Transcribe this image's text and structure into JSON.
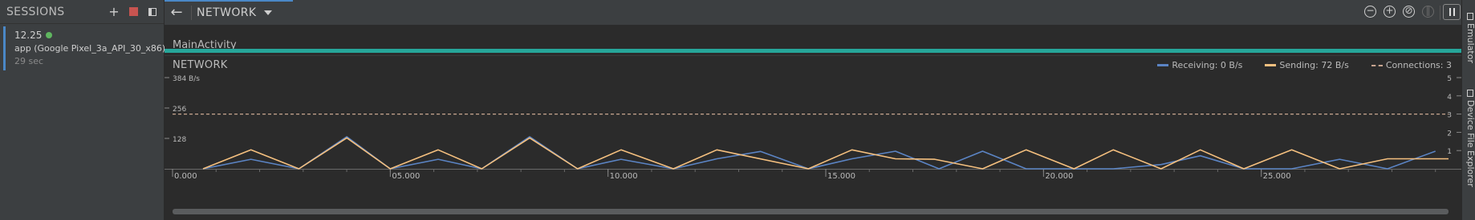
{
  "sessions": {
    "title": "SESSIONS",
    "add_icon": "plus-icon",
    "stop_icon": "stop-icon",
    "panel_icon": "panel-toggle-icon",
    "item": {
      "time": "12.25",
      "app": "app (Google Pixel_3a_API_30_x86)",
      "duration": "29 sec",
      "status_color": "#5fb65f"
    }
  },
  "toolbar": {
    "back_icon": "arrow-left-icon",
    "profiler_label": "NETWORK",
    "zoom_out_icon": "zoom-out-icon",
    "zoom_in_icon": "zoom-in-icon",
    "reset_zoom_icon": "reset-zoom-icon",
    "live_icon": "go-live-icon",
    "pause_icon": "pause-icon"
  },
  "activity": {
    "label": "MainActivity",
    "color": "#26a69a"
  },
  "side_tabs": {
    "emulator": "Emulator",
    "device_file_explorer": "Device File Explorer"
  },
  "chart_data": {
    "type": "line",
    "title": "NETWORK",
    "legend_position": "top-right",
    "legend": [
      {
        "key": "receiving",
        "label": "Receiving: 0 B/s",
        "color": "#5b84c4",
        "style": "solid"
      },
      {
        "key": "sending",
        "label": "Sending: 72 B/s",
        "color": "#f5c07f",
        "style": "solid"
      },
      {
        "key": "connections",
        "label": "Connections:  3",
        "color": "#c8a590",
        "style": "dashed"
      }
    ],
    "x_ticks": [
      "0.000",
      "05.000",
      "10.000",
      "15.000",
      "20.000",
      "25.000"
    ],
    "x_tick_values": [
      0,
      5,
      10,
      15,
      20,
      25
    ],
    "x_range": [
      0,
      29.3
    ],
    "y_left_ticks": [
      "384 B/s",
      "256",
      "128"
    ],
    "y_left_tick_values": [
      384,
      256,
      128
    ],
    "y_left_range": [
      0,
      384
    ],
    "y_right_ticks": [
      "5",
      "4",
      "3",
      "2",
      "1"
    ],
    "y_right_tick_values": [
      5,
      4,
      3,
      2,
      1
    ],
    "y_right_range": [
      0,
      5
    ],
    "grid": false,
    "series": [
      {
        "name": "Receiving",
        "axis": "left",
        "color": "#5b84c4",
        "x": [
          0.7,
          1.8,
          2.9,
          4.0,
          5.0,
          6.1,
          7.1,
          8.2,
          9.3,
          10.3,
          11.5,
          12.5,
          13.5,
          14.6,
          15.6,
          16.6,
          17.6,
          18.6,
          19.6,
          20.7,
          21.6,
          22.7,
          23.6,
          24.6,
          25.7,
          26.8,
          27.9,
          29.0
        ],
        "y": [
          0,
          40,
          0,
          135,
          0,
          40,
          0,
          135,
          0,
          40,
          0,
          42,
          73,
          0,
          42,
          74,
          0,
          74,
          0,
          0,
          0,
          18,
          55,
          0,
          0,
          40,
          0,
          74
        ]
      },
      {
        "name": "Sending",
        "axis": "left",
        "color": "#f5c07f",
        "x": [
          0.7,
          1.8,
          2.9,
          4.0,
          5.0,
          6.1,
          7.1,
          8.2,
          9.3,
          10.3,
          11.5,
          12.5,
          14.6,
          15.6,
          16.6,
          17.5,
          18.6,
          19.6,
          20.7,
          21.6,
          22.7,
          23.6,
          24.6,
          25.7,
          26.8,
          27.9,
          28.8,
          29.3
        ],
        "y": [
          0,
          80,
          0,
          130,
          0,
          80,
          0,
          130,
          0,
          80,
          0,
          80,
          0,
          80,
          42,
          40,
          0,
          80,
          0,
          80,
          0,
          80,
          0,
          80,
          0,
          42,
          42,
          42
        ]
      },
      {
        "name": "Connections",
        "axis": "right",
        "color": "#c8a590",
        "style": "dashed",
        "x": [
          0,
          29.3
        ],
        "y": [
          3,
          3
        ]
      }
    ]
  }
}
